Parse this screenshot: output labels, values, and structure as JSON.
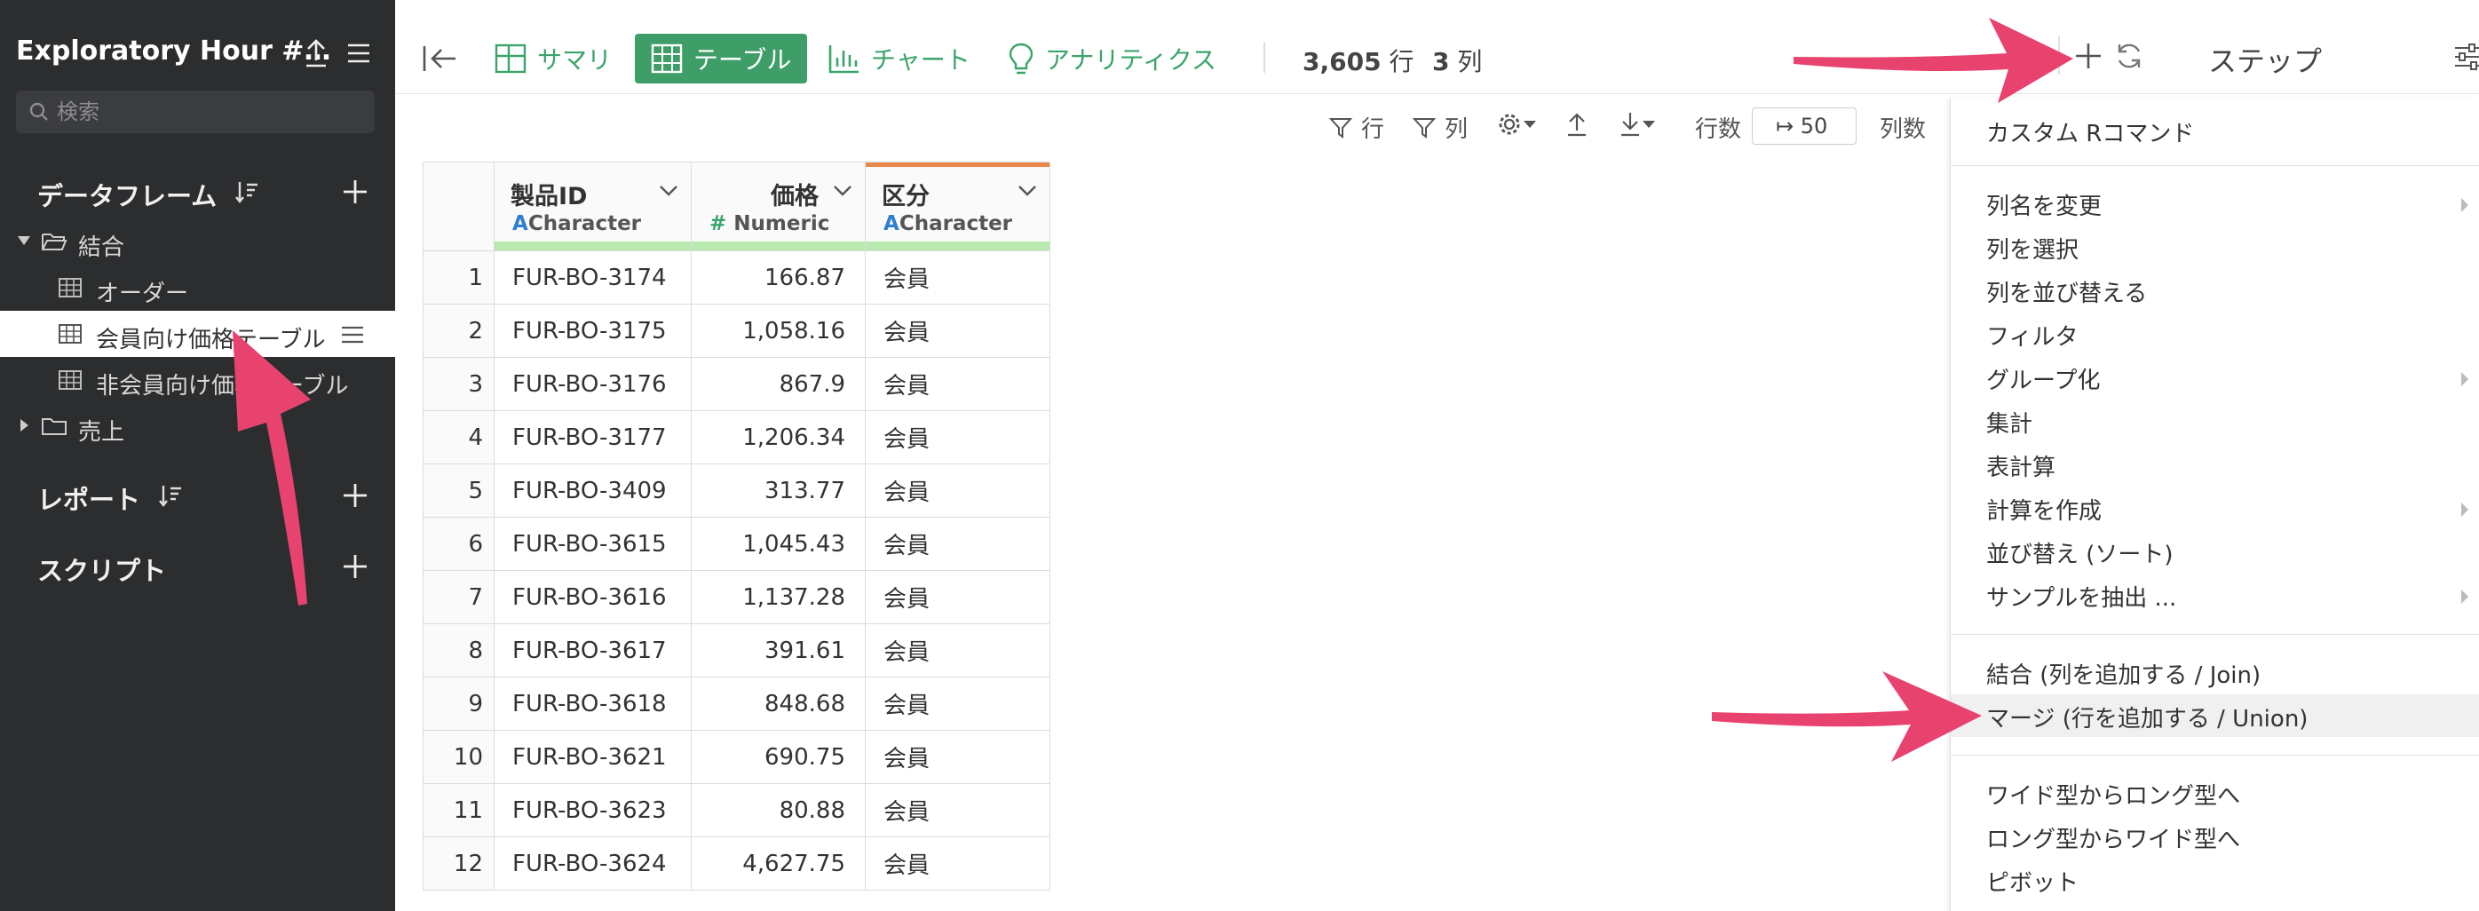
{
  "sidebar": {
    "title": "Exploratory Hour #…",
    "search_placeholder": "検索",
    "sections": {
      "dataframes": "データフレーム",
      "reports": "レポート",
      "scripts": "スクリプト"
    },
    "tree": {
      "folder_join": "結合",
      "order": "オーダー",
      "member_table": "会員向け価格テーブル",
      "nonmember_table": "非会員向け価格テーブル",
      "folder_sales": "売上"
    }
  },
  "toolbar": {
    "tabs": [
      "サマリ",
      "テーブル",
      "チャート",
      "アナリティクス"
    ],
    "row_count": "3,605",
    "row_unit": "行",
    "col_count": "3",
    "col_unit": "列",
    "step_label": "ステップ"
  },
  "subbar": {
    "filter_row": "行",
    "filter_col": "列",
    "rows_label": "行数",
    "rows_value": "↦ 50",
    "cols_label": "列数"
  },
  "table": {
    "columns": [
      {
        "name": "製品ID",
        "type": "Character",
        "type_icon": "A"
      },
      {
        "name": "価格",
        "type": "Numeric",
        "type_icon": "#"
      },
      {
        "name": "区分",
        "type": "Character",
        "type_icon": "A"
      }
    ],
    "rows": [
      [
        "1",
        "FUR-BO-3174",
        "166.87",
        "会員"
      ],
      [
        "2",
        "FUR-BO-3175",
        "1,058.16",
        "会員"
      ],
      [
        "3",
        "FUR-BO-3176",
        "867.9",
        "会員"
      ],
      [
        "4",
        "FUR-BO-3177",
        "1,206.34",
        "会員"
      ],
      [
        "5",
        "FUR-BO-3409",
        "313.77",
        "会員"
      ],
      [
        "6",
        "FUR-BO-3615",
        "1,045.43",
        "会員"
      ],
      [
        "7",
        "FUR-BO-3616",
        "1,137.28",
        "会員"
      ],
      [
        "8",
        "FUR-BO-3617",
        "391.61",
        "会員"
      ],
      [
        "9",
        "FUR-BO-3618",
        "848.68",
        "会員"
      ],
      [
        "10",
        "FUR-BO-3621",
        "690.75",
        "会員"
      ],
      [
        "11",
        "FUR-BO-3623",
        "80.88",
        "会員"
      ],
      [
        "12",
        "FUR-BO-3624",
        "4,627.75",
        "会員"
      ]
    ]
  },
  "menu": {
    "custom_r": "カスタム Rコマンド",
    "rename": "列名を変更",
    "select": "列を選択",
    "reorder": "列を並び替える",
    "filter": "フィルタ",
    "group": "グループ化",
    "summarize": "集計",
    "table_calc": "表計算",
    "mutate": "計算を作成",
    "sort": "並び替え (ソート)",
    "sample": "サンプルを抽出 ...",
    "join": "結合 (列を追加する / Join)",
    "union": "マージ (行を追加する / Union)",
    "wide_to_long": "ワイド型からロング型へ",
    "long_to_wide": "ロング型からワイド型へ",
    "pivot": "ピボット"
  },
  "colors": {
    "accent_green": "#3f9e68",
    "annotation_arrow": "#e8436e",
    "sidebar_bg": "#2c2d2f"
  }
}
